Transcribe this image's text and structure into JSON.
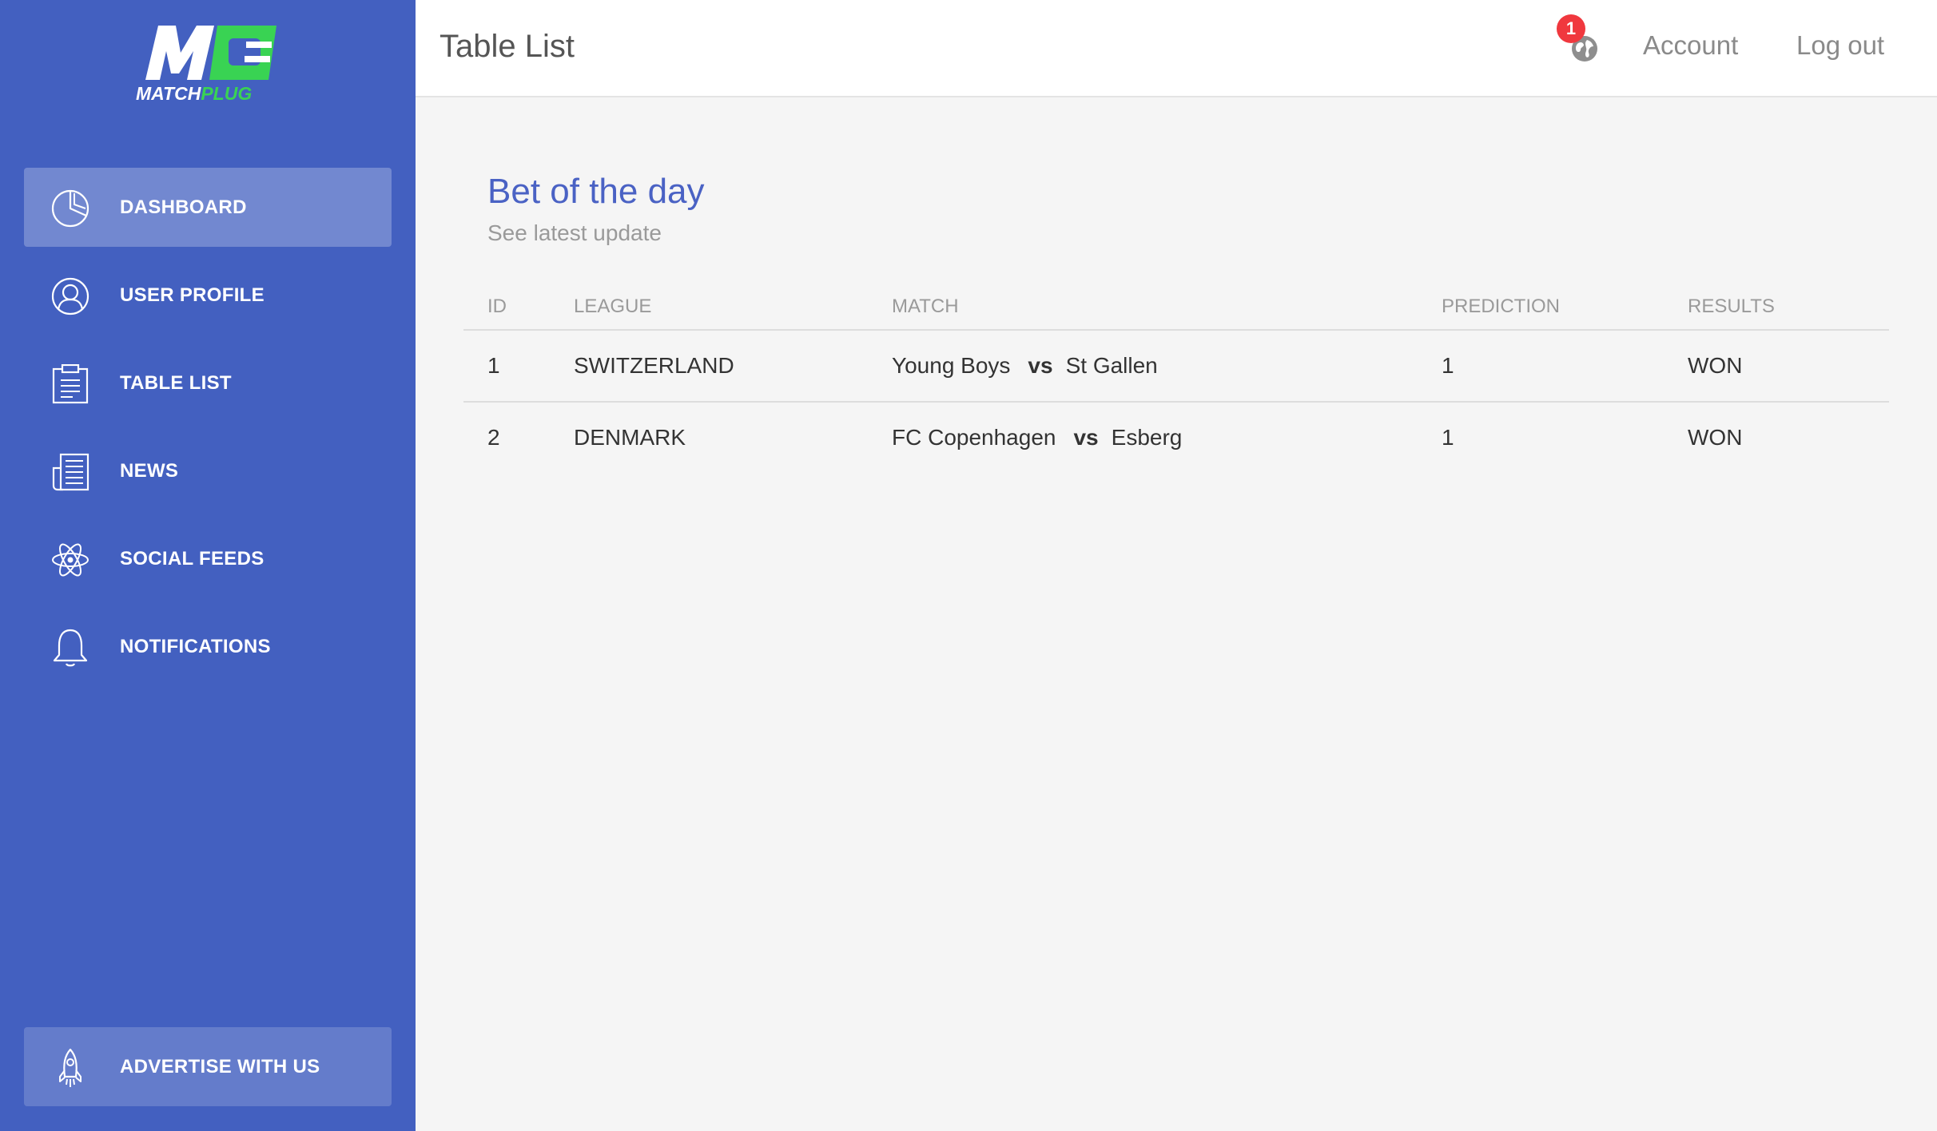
{
  "brand": {
    "name_part1": "MATCH",
    "name_part2": "PLUG",
    "logo_colors": {
      "primary": "#ffffff",
      "accent": "#39d353"
    }
  },
  "sidebar": {
    "background": "#4360c0",
    "items": [
      {
        "label": "DASHBOARD",
        "icon": "pie-chart-icon",
        "active": true
      },
      {
        "label": "USER PROFILE",
        "icon": "user-icon",
        "active": false
      },
      {
        "label": "TABLE LIST",
        "icon": "clipboard-icon",
        "active": false
      },
      {
        "label": "NEWS",
        "icon": "newspaper-icon",
        "active": false
      },
      {
        "label": "SOCIAL FEEDS",
        "icon": "atom-icon",
        "active": false
      },
      {
        "label": "NOTIFICATIONS",
        "icon": "bell-icon",
        "active": false
      }
    ],
    "footer": {
      "label": "ADVERTISE WITH US",
      "icon": "rocket-icon"
    }
  },
  "header": {
    "title": "Table List",
    "notification_count": "1",
    "globe_icon": "globe-icon",
    "account_label": "Account",
    "logout_label": "Log out"
  },
  "card": {
    "title": "Bet of the day",
    "subtitle": "See latest update",
    "columns": [
      "ID",
      "LEAGUE",
      "MATCH",
      "PREDICTION",
      "RESULTS"
    ],
    "rows": [
      {
        "id": "1",
        "league": "SWITZERLAND",
        "home": "Young Boys",
        "vs": "vs",
        "away": "St Gallen",
        "prediction": "1",
        "result": "WON"
      },
      {
        "id": "2",
        "league": "DENMARK",
        "home": "FC Copenhagen",
        "vs": "vs",
        "away": "Esberg",
        "prediction": "1",
        "result": "WON"
      }
    ]
  }
}
